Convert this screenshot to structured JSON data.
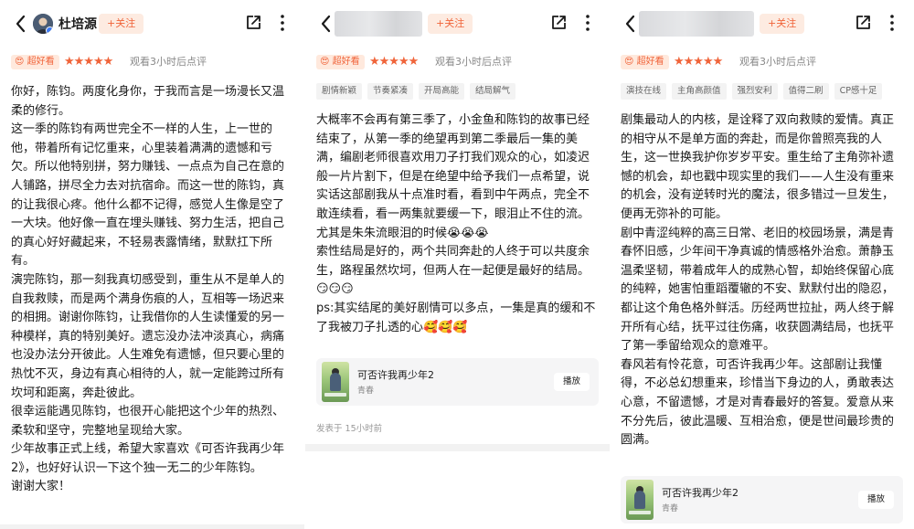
{
  "panels": [
    {
      "author": "杜培源",
      "follow_label": "+关注",
      "rating_badge": "😍 超好看",
      "stars": "★★★★★",
      "rating_note": "观看3小时后点评",
      "paragraphs": [
        "你好，陈钧。两度化身你，于我而言是一场漫长又温柔的修行。",
        "这一季的陈钧有两世完全不一样的人生，上一世的他，带着所有记忆重来，心里装着满满的遗憾和亏欠。所以他特别拼，努力赚钱、一点点为自己在意的人铺路，拼尽全力去对抗宿命。而这一世的陈钧，真的让我很心疼。他什么都不记得，感觉人生像是空了一大块。他好像一直在埋头赚钱、努力生活，把自己的真心好好藏起来，不轻易表露情绪，默默扛下所有。",
        "演完陈钧，那一刻我真切感受到，重生从不是单人的自我救赎，而是两个满身伤痕的人，互相等一场迟来的相拥。谢谢你陈钧，让我借你的人生读懂爱的另一种模样，真的特别美好。遗忘没办法冲淡真心，病痛也没办法分开彼此。人生难免有遗憾，但只要心里的热忱不灭，身边有真心相待的人，就一定能跨过所有坎坷和距离，奔赴彼此。",
        "很幸运能遇见陈钧，也很开心能把这个少年的热烈、柔软和坚守，完整地呈现给大家。",
        "少年故事正式上线，希望大家喜欢《可否许我再少年2》，也好好认识一下这个独一无二的少年陈钧。",
        "谢谢大家！"
      ]
    },
    {
      "follow_label": "+关注",
      "rating_badge": "😍 超好看",
      "stars": "★★★★★",
      "rating_note": "观看3小时后点评",
      "tags": [
        "剧情新颖",
        "节奏紧凑",
        "开局高能",
        "结局解气"
      ],
      "paragraphs": [
        "大概率不会再有第三季了，小金鱼和陈钧的故事已经结束了，从第一季的绝望再到第二季最后一集的美满，编剧老师很喜欢用刀子打我们观众的心，如凌迟般一片片割下，但是在绝望中给予我们一点希望，说实话这部剧我从十点准时看，看到中午两点，完全不敢连续看，看一两集就要缓一下，眼泪止不住的流。",
        "尤其是朱朱流眼泪的时候😭😭😭",
        "索性结局是好的，两个共同奔赴的人终于可以共度余生，路程虽然坎坷，但两人在一起便是最好的结局。",
        "😏😏😏",
        "ps:其实结尾的美好剧情可以多点，一集是真的缓和不了我被刀子扎透的心🥰🥰🥰"
      ],
      "card": {
        "title": "可否许我再少年2",
        "subtitle": "青春",
        "play_label": "播放"
      },
      "posted": "发表于 15小时前"
    },
    {
      "follow_label": "+关注",
      "rating_badge": "😍 超好看",
      "stars": "★★★★★",
      "rating_note": "观看3小时后点评",
      "tags": [
        "演技在线",
        "主角高颜值",
        "强烈安利",
        "值得二刷",
        "CP感十足"
      ],
      "paragraphs": [
        "剧集最动人的内核，是诠释了双向救赎的爱情。真正的相守从不是单方面的奔赴，而是你曾照亮我的人生，这一世换我护你岁岁平安。重生给了主角弥补遗憾的机会，却也戳中现实里的我们——人生没有重来的机会，没有逆转时光的魔法，很多错过一旦发生，便再无弥补的可能。",
        "剧中青涩纯粹的高三日常、老旧的校园场景，满是青春怀旧感，少年间干净真诚的情感格外治愈。萧静玉温柔坚韧，带着成年人的成熟心智，却始终保留心底的纯粹，她害怕重蹈覆辙的不安、默默付出的隐忍，都让这个角色格外鲜活。历经两世拉扯，两人终于解开所有心结，抚平过往伤痛，收获圆满结局，也抚平了第一季留给观众的意难平。",
        "春风若有怜花意，可否许我再少年。这部剧让我懂得，不必总幻想重来，珍惜当下身边的人，勇敢表达心意，不留遗憾，才是对青春最好的答复。爱意从来不分先后，彼此温暖、互相治愈，便是世间最珍贵的圆满。"
      ],
      "card": {
        "title": "可否许我再少年2",
        "subtitle": "青春",
        "play_label": "播放"
      }
    }
  ]
}
